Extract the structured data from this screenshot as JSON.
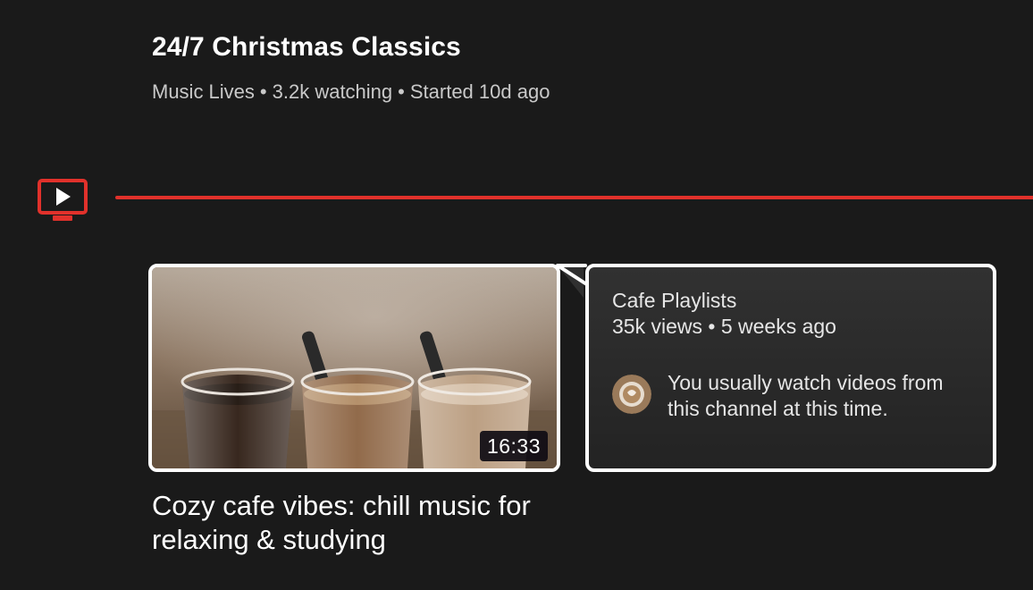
{
  "now_playing": {
    "title": "24/7 Christmas Classics",
    "channel": "Music Lives",
    "viewers": "3.2k watching",
    "started": "Started 10d ago",
    "separator": "•"
  },
  "row": {
    "icon": "tv-play-icon",
    "accent_color": "#e1312b"
  },
  "video": {
    "title": "Cozy cafe vibes: chill music for relaxing & studying",
    "duration": "16:33",
    "thumbnail_icon": "coffee-glasses-image",
    "channel": "Cafe Playlists",
    "stats": "35k views • 5 weeks ago",
    "avatar_icon": "latte-art-avatar",
    "habit_note": "You usually watch videos from this channel at this time."
  }
}
